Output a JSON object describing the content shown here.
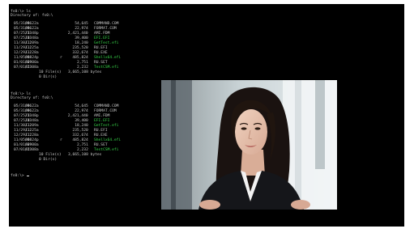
{
  "terminal": {
    "cmd1": "fs0:\\> ls",
    "dir1": "Directory of: fs0:\\",
    "rows1": [
      {
        "date": "05/31/96",
        "time": "06:22a",
        "attr": "",
        "size": "54,645",
        "name": "COMMAND.COM",
        "green": false
      },
      {
        "date": "05/31/96",
        "time": "06:22a",
        "attr": "",
        "size": "22,974",
        "name": "FORMAT.COM",
        "green": false
      },
      {
        "date": "07/25/13",
        "time": "23:48p",
        "attr": "",
        "size": "2,421,440",
        "name": "AMI.FDM",
        "green": false
      },
      {
        "date": "07/25/13",
        "time": "10:48a",
        "attr": "",
        "size": "39,400",
        "name": "EFI.EFI",
        "green": true
      },
      {
        "date": "11/30/12",
        "time": "11:09a",
        "attr": "",
        "size": "18,240",
        "name": "GetTest.efi",
        "green": true
      },
      {
        "date": "11/29/12",
        "time": "11:25a",
        "attr": "",
        "size": "235,520",
        "name": "RU.EFI",
        "green": false
      },
      {
        "date": "12/29/12",
        "time": "11:28a",
        "attr": "",
        "size": "332,674",
        "name": "RU.EXE",
        "green": false
      },
      {
        "date": "11/05/08",
        "time": "06:24p",
        "attr": "r",
        "size": "485,824",
        "name": "Shellx64.efi",
        "green": true
      },
      {
        "date": "01/01/09",
        "time": "02:00a",
        "attr": "",
        "size": "2,751",
        "name": "RU.SET",
        "green": false
      },
      {
        "date": "07/01/13",
        "time": "02:08a",
        "attr": "",
        "size": "2,232",
        "name": "TestCSM.efi",
        "green": true
      }
    ],
    "summary1a": "10 File(s)   3,665,108 bytes",
    "summary1b": "0 Dir(s)",
    "cmd2": "fs0:\\> ls",
    "dir2": "Directory of: fs0:\\",
    "rows2": [
      {
        "date": "05/31/96",
        "time": "06:22a",
        "attr": "",
        "size": "54,645",
        "name": "COMMAND.COM",
        "green": false
      },
      {
        "date": "05/31/96",
        "time": "06:22a",
        "attr": "",
        "size": "22,974",
        "name": "FORMAT.COM",
        "green": false
      },
      {
        "date": "07/25/13",
        "time": "23:48p",
        "attr": "",
        "size": "2,421,440",
        "name": "AMI.FDM",
        "green": false
      },
      {
        "date": "07/25/13",
        "time": "10:48a",
        "attr": "",
        "size": "39,400",
        "name": "EFI.EFI",
        "green": true
      },
      {
        "date": "11/30/12",
        "time": "11:09a",
        "attr": "",
        "size": "18,240",
        "name": "GetTest.efi",
        "green": true
      },
      {
        "date": "11/29/12",
        "time": "11:25a",
        "attr": "",
        "size": "235,520",
        "name": "RU.EFI",
        "green": false
      },
      {
        "date": "12/29/12",
        "time": "11:28a",
        "attr": "",
        "size": "332,674",
        "name": "RU.EXE",
        "green": false
      },
      {
        "date": "11/05/08",
        "time": "06:24p",
        "attr": "r",
        "size": "485,824",
        "name": "Shellx64.efi",
        "green": true
      },
      {
        "date": "01/01/09",
        "time": "02:00a",
        "attr": "",
        "size": "2,751",
        "name": "RU.SET",
        "green": false
      },
      {
        "date": "07/01/13",
        "time": "02:08a",
        "attr": "",
        "size": "2,232",
        "name": "TestCSM.efi",
        "green": true
      }
    ],
    "summary2a": "10 File(s)   3,665,108 bytes",
    "summary2b": "0 Dir(s)",
    "prompt": "fs0:\\>"
  },
  "colors": {
    "background": "#000000",
    "text": "#c9c9c9",
    "executable": "#38d84a"
  },
  "photo": {
    "icon": "woman-portrait-photo"
  }
}
